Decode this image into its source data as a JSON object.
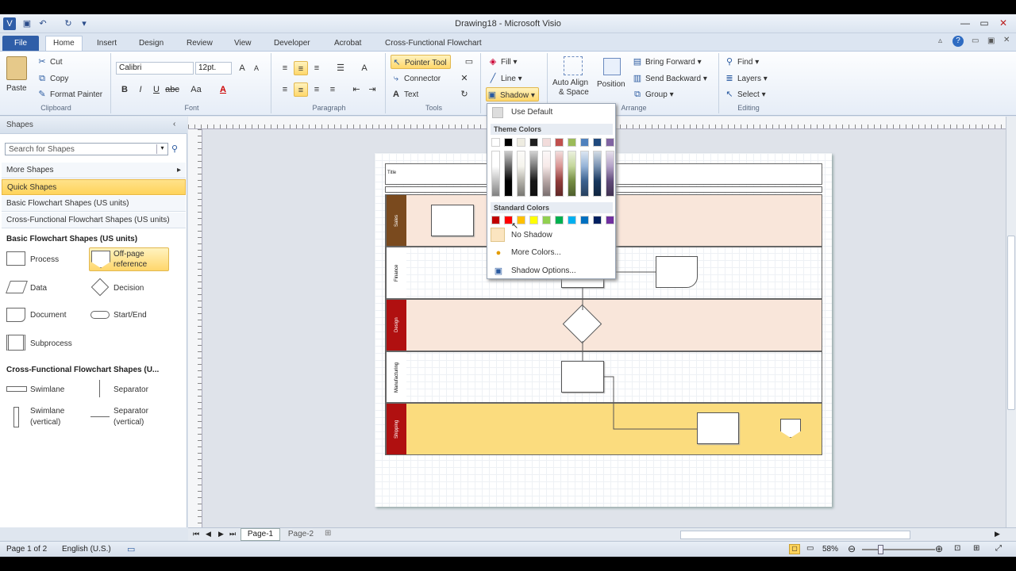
{
  "window": {
    "title": "Drawing18 - Microsoft Visio"
  },
  "tabs": [
    "File",
    "Home",
    "Insert",
    "Design",
    "Review",
    "View",
    "Developer",
    "Acrobat",
    "Cross-Functional Flowchart"
  ],
  "ribbon": {
    "clipboard": {
      "paste": "Paste",
      "cut": "Cut",
      "copy": "Copy",
      "format_painter": "Format Painter",
      "label": "Clipboard"
    },
    "font": {
      "name": "Calibri",
      "size": "12pt.",
      "label": "Font"
    },
    "paragraph": {
      "label": "Paragraph"
    },
    "tools": {
      "pointer": "Pointer Tool",
      "connector": "Connector",
      "text": "Text",
      "label": "Tools"
    },
    "shape": {
      "fill": "Fill",
      "line": "Line",
      "shadow": "Shadow"
    },
    "arrange": {
      "auto_align": "Auto Align",
      "space": "& Space",
      "position": "Position",
      "bring_forward": "Bring Forward",
      "send_backward": "Send Backward",
      "group": "Group",
      "label": "Arrange"
    },
    "editing": {
      "find": "Find",
      "layers": "Layers",
      "select": "Select",
      "label": "Editing"
    }
  },
  "shapes_pane": {
    "title": "Shapes",
    "search_placeholder": "Search for Shapes",
    "more_shapes": "More Shapes",
    "quick_shapes": "Quick Shapes",
    "stencils": [
      "Basic Flowchart Shapes (US units)",
      "Cross-Functional Flowchart Shapes (US units)"
    ],
    "section1": "Basic Flowchart Shapes (US units)",
    "section1_items": {
      "process": "Process",
      "offpage1": "Off-page",
      "offpage2": "reference",
      "data": "Data",
      "decision": "Decision",
      "document": "Document",
      "startend": "Start/End",
      "subprocess": "Subprocess"
    },
    "section2": "Cross-Functional Flowchart Shapes (U...",
    "section2_items": {
      "swimlane": "Swimlane",
      "separator": "Separator",
      "swimlane_v1": "Swimlane",
      "swimlane_v2": "(vertical)",
      "separator_v1": "Separator",
      "separator_v2": "(vertical)"
    }
  },
  "diagram": {
    "title": "Title",
    "lanes": [
      {
        "label": "Sales",
        "color": "#7a4a1e"
      },
      {
        "label": "Finance",
        "color": "#ffffff"
      },
      {
        "label": "Design",
        "color": "#b01010"
      },
      {
        "label": "Manufacturing",
        "color": "#ffffff"
      },
      {
        "label": "Shipping",
        "color": "#b01010"
      }
    ]
  },
  "shadow_menu": {
    "use_default": "Use Default",
    "theme_colors": "Theme Colors",
    "standard_colors": "Standard Colors",
    "no_shadow": "No Shadow",
    "more_colors": "More Colors...",
    "shadow_options": "Shadow Options...",
    "theme_top": [
      "#ffffff",
      "#000000",
      "#eeece1",
      "#1f1f1f",
      "#f2dcdb",
      "#c0504d",
      "#9bbb59",
      "#4f81bd",
      "#1f497d",
      "#8064a2"
    ],
    "standard": [
      "#c00000",
      "#ff0000",
      "#ffc000",
      "#ffff00",
      "#92d050",
      "#00b050",
      "#00b0f0",
      "#0070c0",
      "#002060",
      "#7030a0"
    ]
  },
  "page_tabs": [
    "Page-1",
    "Page-2"
  ],
  "status": {
    "page": "Page 1 of 2",
    "language": "English (U.S.)",
    "zoom": "58%"
  }
}
